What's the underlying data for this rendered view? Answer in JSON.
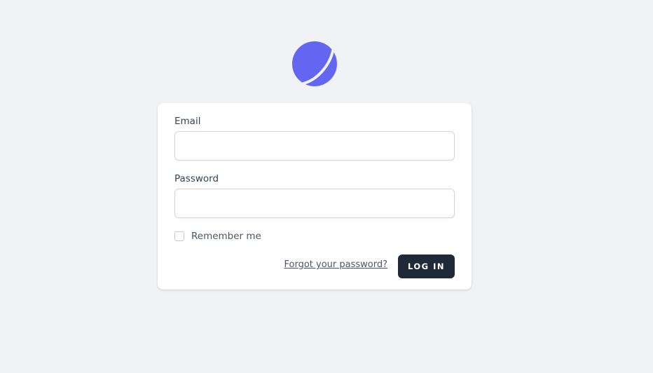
{
  "brand": {
    "logo_icon": "planet-logo-icon",
    "accent_color": "#6366f1"
  },
  "form": {
    "email_label": "Email",
    "email_value": "",
    "email_placeholder": "",
    "password_label": "Password",
    "password_value": "",
    "password_placeholder": "",
    "remember_label": "Remember me",
    "remember_checked": false,
    "forgot_link": "Forgot your password?",
    "login_button": "LOG IN"
  },
  "colors": {
    "background": "#f0f2f6",
    "card": "#ffffff",
    "button": "#1f2937"
  }
}
